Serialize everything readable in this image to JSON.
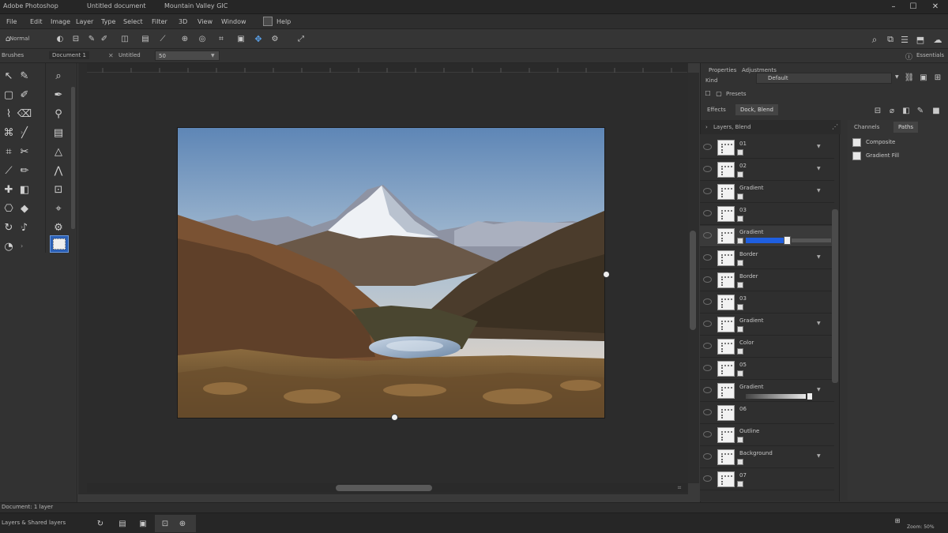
{
  "window": {
    "title_left": "Adobe Photoshop",
    "title_doc": "Untitled document",
    "title_right": "Mountain Valley GIC"
  },
  "menu": [
    "File",
    "Edit",
    "Image",
    "Layer",
    "Type",
    "Select",
    "Filter",
    "3D",
    "View",
    "Window",
    "Help"
  ],
  "options": {
    "mode_label": "Normal",
    "workspace_label": "Essentials",
    "search_icon": "search-icon"
  },
  "subbar": {
    "tool_group": "Brushes",
    "document_tab": "Document 1",
    "document_tab2": "Untitled",
    "zoom": "50"
  },
  "right_panel": {
    "top_tabs": [
      "Properties",
      "Adjustments"
    ],
    "preset_label": "Presets",
    "preset_value": "Default",
    "kind_label": "Kind",
    "tabs2": [
      "Effects",
      "Dock, Blend"
    ],
    "layers_header": "Layers, Blend",
    "channels_tabs": [
      "Channels",
      "Paths"
    ],
    "channels": [
      "Composite",
      "Gradient Fill"
    ]
  },
  "layers": [
    {
      "name": "01"
    },
    {
      "name": "02"
    },
    {
      "name": "Gradient"
    },
    {
      "name": "03"
    },
    {
      "name": "Gradient",
      "selected": true
    },
    {
      "name": "Border"
    },
    {
      "name": "Border"
    },
    {
      "name": "03"
    },
    {
      "name": "Gradient"
    },
    {
      "name": "Color"
    },
    {
      "name": "05"
    },
    {
      "name": "Gradient"
    },
    {
      "name": "06"
    },
    {
      "name": "Outline"
    },
    {
      "name": "Background"
    },
    {
      "name": "07"
    }
  ],
  "status": {
    "doc_info": "Document: 1 layer",
    "bottom_left": "Layers & Shared layers",
    "bottom_right": "Zoom: 50%"
  },
  "colors": {
    "accent": "#1f5fe0",
    "sky_top": "#5e86b6",
    "sky_bottom": "#f0d9c2"
  }
}
